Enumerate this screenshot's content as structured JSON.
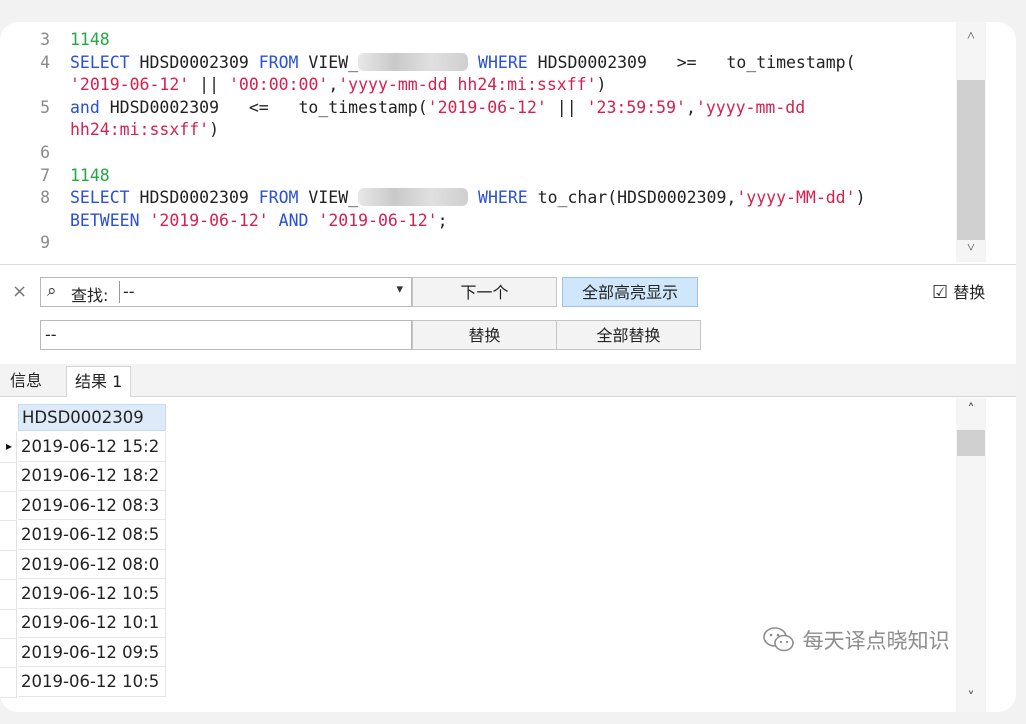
{
  "editor": {
    "lines": [
      {
        "num": "3",
        "segments": [
          {
            "t": "1148",
            "c": "cm"
          }
        ]
      },
      {
        "num": "4",
        "segments": [
          {
            "t": "SELECT",
            "c": "kw"
          },
          {
            "t": " HDSD0002309 "
          },
          {
            "t": "FROM",
            "c": "kw"
          },
          {
            "t": " VIEW_"
          },
          {
            "blur": true
          },
          {
            "t": " "
          },
          {
            "t": "WHERE",
            "c": "kw"
          },
          {
            "t": " HDSD0002309   >=   to_timestamp("
          }
        ]
      },
      {
        "num": "",
        "segments": [
          {
            "t": "'2019-06-12'",
            "c": "str"
          },
          {
            "t": " || "
          },
          {
            "t": "'00:00:00'",
            "c": "str"
          },
          {
            "t": ","
          },
          {
            "t": "'yyyy-mm-dd hh24:mi:ssxff'",
            "c": "str"
          },
          {
            "t": ")"
          }
        ]
      },
      {
        "num": "5",
        "segments": [
          {
            "t": "and",
            "c": "kw"
          },
          {
            "t": " HDSD0002309   <=   to_timestamp("
          },
          {
            "t": "'2019-06-12'",
            "c": "str"
          },
          {
            "t": " || "
          },
          {
            "t": "'23:59:59'",
            "c": "str"
          },
          {
            "t": ","
          },
          {
            "t": "'yyyy-mm-dd",
            "c": "str"
          }
        ]
      },
      {
        "num": "",
        "segments": [
          {
            "t": "hh24:mi:ssxff'",
            "c": "str"
          },
          {
            "t": ")"
          }
        ]
      },
      {
        "num": "6",
        "segments": []
      },
      {
        "num": "7",
        "segments": [
          {
            "t": "1148",
            "c": "cm"
          }
        ]
      },
      {
        "num": "8",
        "segments": [
          {
            "t": "SELECT",
            "c": "kw"
          },
          {
            "t": " HDSD0002309 "
          },
          {
            "t": "FROM",
            "c": "kw"
          },
          {
            "t": " VIEW_"
          },
          {
            "blur": true
          },
          {
            "t": " "
          },
          {
            "t": "WHERE",
            "c": "kw"
          },
          {
            "t": " to_char(HDSD0002309,"
          },
          {
            "t": "'yyyy-MM-dd'",
            "c": "str"
          },
          {
            "t": ")"
          }
        ]
      },
      {
        "num": "",
        "segments": [
          {
            "t": "BETWEEN",
            "c": "kw"
          },
          {
            "t": " "
          },
          {
            "t": "'2019-06-12'",
            "c": "str"
          },
          {
            "t": " "
          },
          {
            "t": "AND",
            "c": "kw"
          },
          {
            "t": " "
          },
          {
            "t": "'2019-06-12'",
            "c": "str"
          },
          {
            "t": ";"
          }
        ]
      },
      {
        "num": "9",
        "segments": []
      }
    ]
  },
  "find_bar": {
    "close_glyph": "×",
    "search_glyph": "⌕",
    "search_label": "查找:",
    "search_value": "--",
    "dropdown_glyph": "▾",
    "next_button": "下一个",
    "highlight_all_button": "全部高亮显示",
    "replace_checkbox_glyph": "☑",
    "replace_checkbox_label": "替换",
    "replace_value": "--",
    "replace_button": "替换",
    "replace_all_button": "全部替换"
  },
  "scroll": {
    "up_glyph": "˄",
    "down_glyph": "˅"
  },
  "tabs": [
    {
      "label": "信息",
      "active": false
    },
    {
      "label": "结果 1",
      "active": true
    }
  ],
  "results": {
    "column_header": "HDSD0002309",
    "current_row_marker": "▸",
    "rows": [
      "2019-06-12 15:2",
      "2019-06-12 18:2",
      "2019-06-12 08:3",
      "2019-06-12 08:5",
      "2019-06-12 08:0",
      "2019-06-12 10:5",
      "2019-06-12 10:1",
      "2019-06-12 09:5",
      "2019-06-12 10:5"
    ]
  },
  "watermark": {
    "icon": "wechat-icon",
    "text": "每天译点晓知识"
  },
  "colors": {
    "keyword": "#2a4fd8",
    "string": "#d6204f",
    "comment": "#22a844",
    "active_button": "#cfe6fb",
    "grid_header": "#ddeaf8"
  }
}
